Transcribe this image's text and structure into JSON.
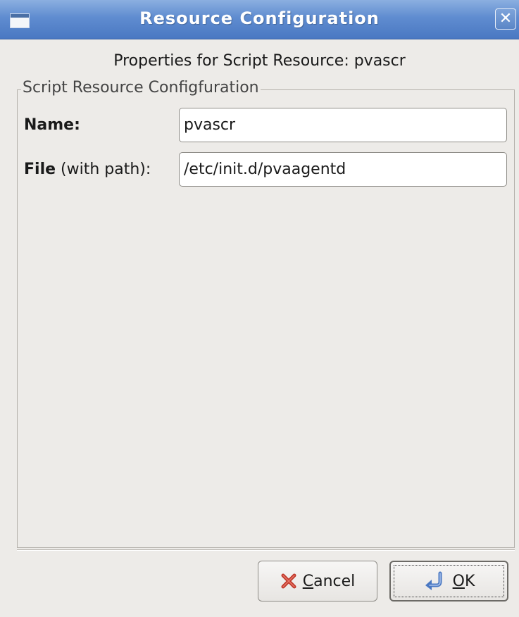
{
  "window": {
    "title": "Resource Configuration",
    "close_glyph": "✕",
    "icon": "window-icon"
  },
  "dialog": {
    "header": "Properties for Script Resource: pvascr",
    "frame_legend": "Script Resource Configfuration"
  },
  "fields": {
    "name": {
      "label_bold": "Name:",
      "value": "pvascr"
    },
    "file": {
      "label_bold": "File",
      "label_rest": " (with path):",
      "value": "/etc/init.d/pvaagentd"
    }
  },
  "buttons": {
    "cancel": {
      "mnemonic": "C",
      "rest": "ancel",
      "icon": "cancel-x-icon"
    },
    "ok": {
      "mnemonic": "O",
      "rest": "K",
      "icon": "return-arrow-icon"
    }
  },
  "colors": {
    "titlebar": "#5f8cd0",
    "window_bg": "#edebe8",
    "cancel_icon": "#c0392b",
    "ok_icon": "#4a78c2"
  }
}
